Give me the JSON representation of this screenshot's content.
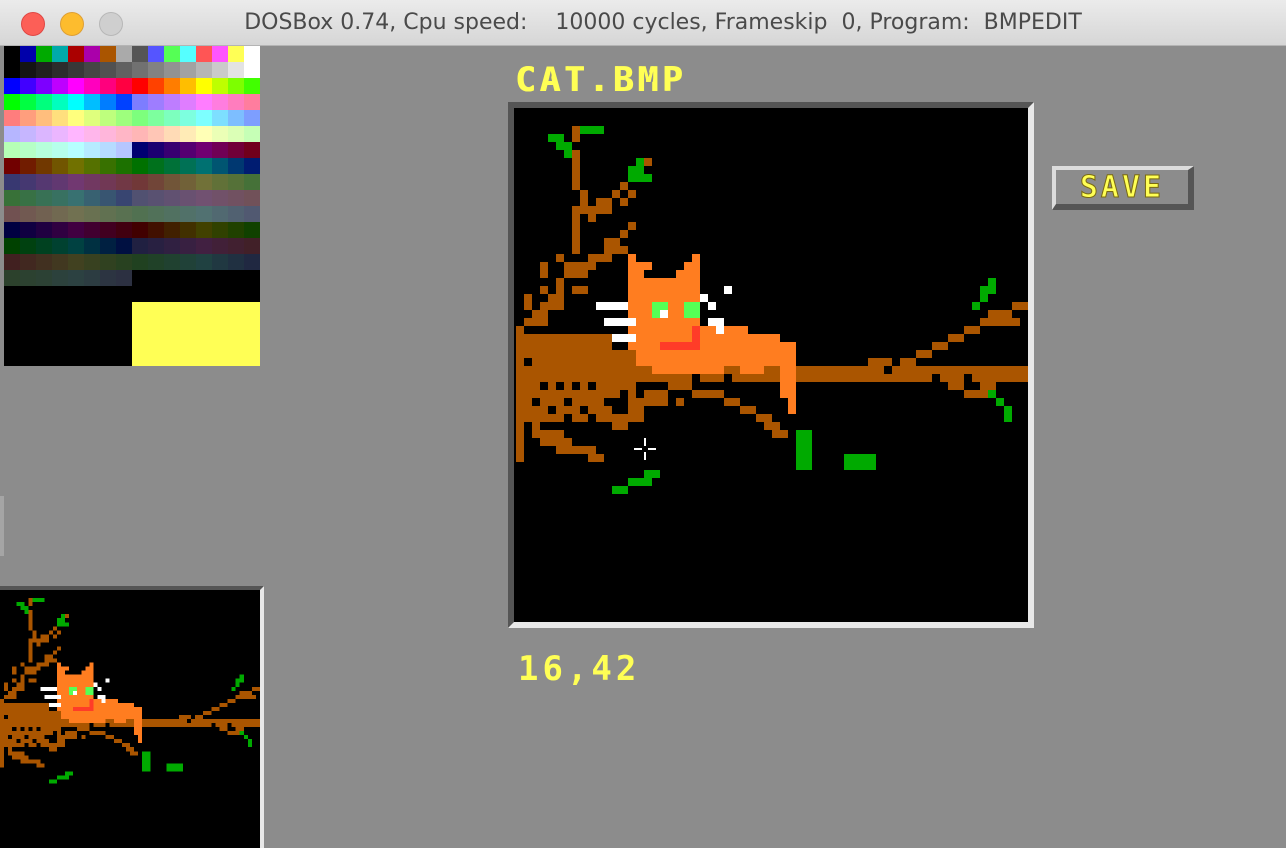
{
  "window": {
    "title": "DOSBox 0.74, Cpu speed:    10000 cycles, Frameskip  0, Program:  BMPEDIT",
    "buttons": [
      "close",
      "minimize",
      "zoom"
    ]
  },
  "editor": {
    "file_name": "CAT.BMP",
    "coords": "16,42",
    "save_label": "SAVE",
    "selected_color": "#ffff55",
    "cursor_icon": "crosshair-icon"
  },
  "palette": {
    "rows": [
      [
        "#000000",
        "#0000aa",
        "#00aa00",
        "#00aaaa",
        "#aa0000",
        "#aa00aa",
        "#aa5500",
        "#aaaaaa",
        "#555555",
        "#5555ff",
        "#55ff55",
        "#55ffff",
        "#ff5555",
        "#ff55ff",
        "#ffff55",
        "#ffffff"
      ],
      [
        "#000000",
        "#141414",
        "#202020",
        "#2c2c2c",
        "#383838",
        "#454545",
        "#515151",
        "#616161",
        "#717171",
        "#828282",
        "#929292",
        "#a2a2a2",
        "#b6b6b6",
        "#cacaca",
        "#e3e3e3",
        "#ffffff"
      ],
      [
        "#0000ff",
        "#4100ff",
        "#7d00ff",
        "#be00ff",
        "#ff00ff",
        "#ff00be",
        "#ff007d",
        "#ff0041",
        "#ff0000",
        "#ff4100",
        "#ff7d00",
        "#ffbe00",
        "#ffff00",
        "#beff00",
        "#7dff00",
        "#41ff00"
      ],
      [
        "#00ff00",
        "#00ff41",
        "#00ff7d",
        "#00ffbe",
        "#00ffff",
        "#00beff",
        "#007dff",
        "#0041ff",
        "#7d7dff",
        "#9e7dff",
        "#be7dff",
        "#df7dff",
        "#ff7dff",
        "#ff7ddf",
        "#ff7dbe",
        "#ff7d9e"
      ],
      [
        "#ff7d7d",
        "#ff9e7d",
        "#ffbe7d",
        "#ffdf7d",
        "#ffff7d",
        "#dfff7d",
        "#beff7d",
        "#9eff7d",
        "#7dff7d",
        "#7dff9e",
        "#7dffbe",
        "#7dffdf",
        "#7dffff",
        "#7ddfff",
        "#7dbeff",
        "#7d9eff"
      ],
      [
        "#b6b6ff",
        "#c6b6ff",
        "#dbb6ff",
        "#ebb6ff",
        "#ffb6ff",
        "#ffb6eb",
        "#ffb6db",
        "#ffb6c6",
        "#ffb6b6",
        "#ffc6b6",
        "#ffdbb6",
        "#ffebb6",
        "#ffffb6",
        "#ebffb6",
        "#dbffb6",
        "#c6ffb6"
      ],
      [
        "#b6ffb6",
        "#b6ffc6",
        "#b6ffdb",
        "#b6ffeb",
        "#b6ffff",
        "#b6ebff",
        "#b6dbff",
        "#b6c6ff",
        "#000071",
        "#1c0071",
        "#380071",
        "#550071",
        "#710071",
        "#710055",
        "#710038",
        "#71001c"
      ],
      [
        "#710000",
        "#711c00",
        "#713800",
        "#715500",
        "#717100",
        "#557100",
        "#387100",
        "#1c7100",
        "#007100",
        "#00711c",
        "#007138",
        "#007155",
        "#007171",
        "#005571",
        "#003871",
        "#001c71"
      ],
      [
        "#383871",
        "#453871",
        "#553871",
        "#613871",
        "#713871",
        "#713861",
        "#713855",
        "#713845",
        "#713838",
        "#714538",
        "#715538",
        "#716138",
        "#717138",
        "#617138",
        "#557138",
        "#457138"
      ],
      [
        "#387138",
        "#387145",
        "#387155",
        "#387161",
        "#387171",
        "#386171",
        "#385571",
        "#384571",
        "#515171",
        "#595171",
        "#615171",
        "#695171",
        "#715171",
        "#715169",
        "#715161",
        "#715159"
      ],
      [
        "#715151",
        "#715951",
        "#716151",
        "#716951",
        "#717151",
        "#697151",
        "#617151",
        "#597151",
        "#517151",
        "#517159",
        "#517161",
        "#517169",
        "#517171",
        "#516971",
        "#516171",
        "#515971"
      ],
      [
        "#000041",
        "#100041",
        "#200041",
        "#300041",
        "#410041",
        "#410030",
        "#410020",
        "#410010",
        "#410000",
        "#411000",
        "#412000",
        "#413000",
        "#414100",
        "#304100",
        "#204100",
        "#104100"
      ],
      [
        "#004100",
        "#004110",
        "#004120",
        "#004130",
        "#004141",
        "#003041",
        "#002041",
        "#001041",
        "#202041",
        "#282041",
        "#302041",
        "#382041",
        "#412041",
        "#412038",
        "#412030",
        "#412028"
      ],
      [
        "#412020",
        "#412820",
        "#413020",
        "#413820",
        "#414120",
        "#384120",
        "#304120",
        "#284120",
        "#204120",
        "#204128",
        "#204130",
        "#204138",
        "#204141",
        "#203841",
        "#203041",
        "#202841"
      ],
      [
        "#2c412c",
        "#2c4130",
        "#2c4134",
        "#2c413c",
        "#2c4141",
        "#2c3c41",
        "#2c3441",
        "#2c3041",
        "#000000",
        "#000000",
        "#000000",
        "#000000",
        "#000000",
        "#000000",
        "#000000",
        "#000000"
      ]
    ]
  },
  "colors": {
    "background": "#8c8c8c",
    "bark": "#aa5500",
    "fur": "#ff7d20",
    "leaf": "#00aa00",
    "eyes": "#55ff55",
    "mouth": "#ff3c28",
    "whisker": "#ffffff",
    "text": "#ffff55"
  }
}
